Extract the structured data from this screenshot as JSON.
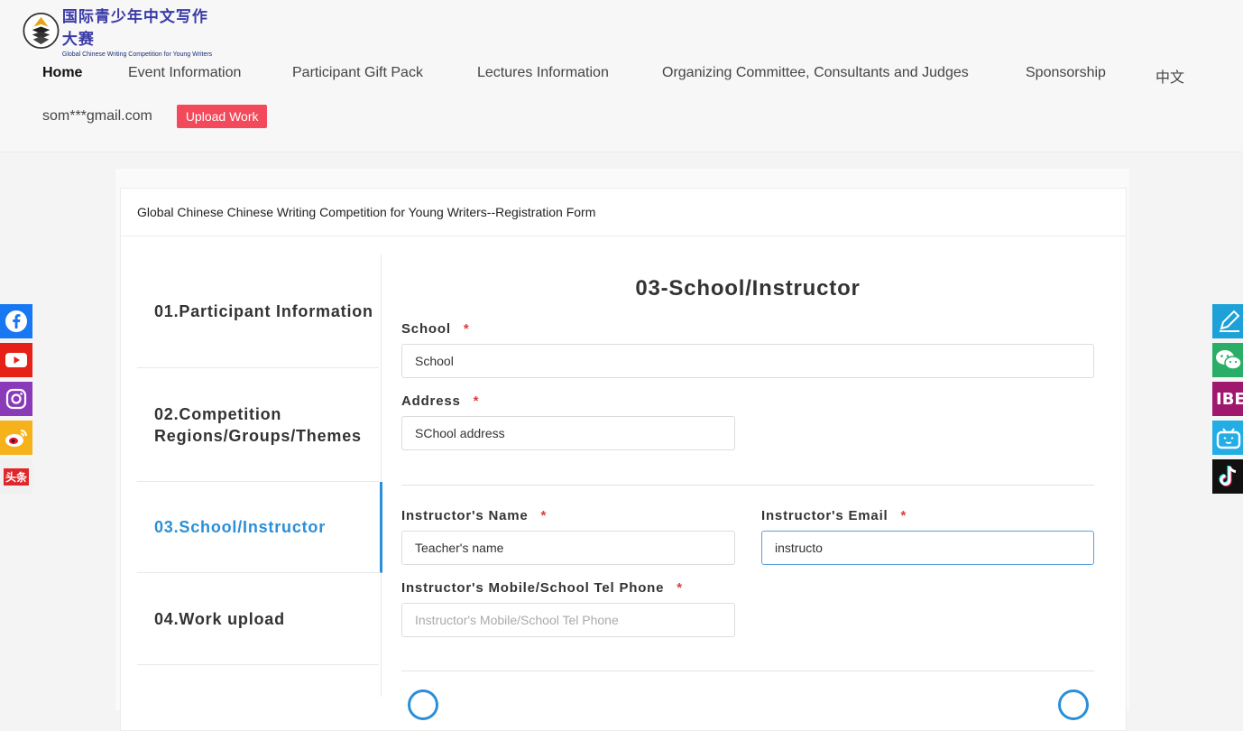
{
  "brand": {
    "cn_name": "国际青少年中文写作大赛",
    "en_name": "Global Chinese Writing Competition for Young Writers"
  },
  "nav": {
    "items": [
      {
        "label": "Home",
        "active": true
      },
      {
        "label": "Event Information"
      },
      {
        "label": "Participant Gift Pack"
      },
      {
        "label": "Lectures Information"
      },
      {
        "label": "Organizing Committee, Consultants and Judges"
      },
      {
        "label": "Sponsorship"
      },
      {
        "label": "中文"
      }
    ],
    "user_email": "som***gmail.com",
    "upload_label": "Upload Work"
  },
  "form": {
    "title": "Global Chinese Chinese Writing Competition for Young Writers--Registration Form",
    "steps": [
      {
        "label": "01.Participant Information"
      },
      {
        "label": "02.Competition Regions/Groups/Themes"
      },
      {
        "label": "03.School/Instructor",
        "active": true
      },
      {
        "label": "04.Work upload"
      }
    ],
    "section_heading": "03-School/Instructor",
    "required_mark": "*",
    "fields": {
      "school": {
        "label": "School",
        "value": "School"
      },
      "address": {
        "label": "Address",
        "value": "SChool address"
      },
      "instructor_name": {
        "label": "Instructor's Name",
        "value": "Teacher's name"
      },
      "instructor_email": {
        "label": "Instructor's Email",
        "value": "instructo"
      },
      "instructor_phone": {
        "label": "Instructor's Mobile/School Tel Phone",
        "value": "",
        "placeholder": "Instructor's Mobile/School Tel Phone"
      }
    }
  },
  "social_left": [
    {
      "icon": "facebook-icon",
      "color": "#1877f2"
    },
    {
      "icon": "youtube-icon",
      "color": "#e62117"
    },
    {
      "icon": "instagram-icon",
      "color": "#8a3ab9"
    },
    {
      "icon": "weibo-icon",
      "color": "#f5b21b"
    },
    {
      "icon": "toutiao-icon",
      "color": "#f0f0f0",
      "text": "头条"
    }
  ],
  "social_right": [
    {
      "icon": "pen-icon",
      "color": "#1da1d8"
    },
    {
      "icon": "wechat-icon",
      "color": "#2aae67"
    },
    {
      "icon": "ibe-icon",
      "color": "#a0176e",
      "text": "IBE"
    },
    {
      "icon": "bilibili-icon",
      "color": "#23ade5"
    },
    {
      "icon": "tiktok-icon",
      "color": "#111111"
    }
  ],
  "colors": {
    "accent": "#2a8fd8",
    "upload_button": "#f24a5b",
    "required": "#e23a3a"
  }
}
